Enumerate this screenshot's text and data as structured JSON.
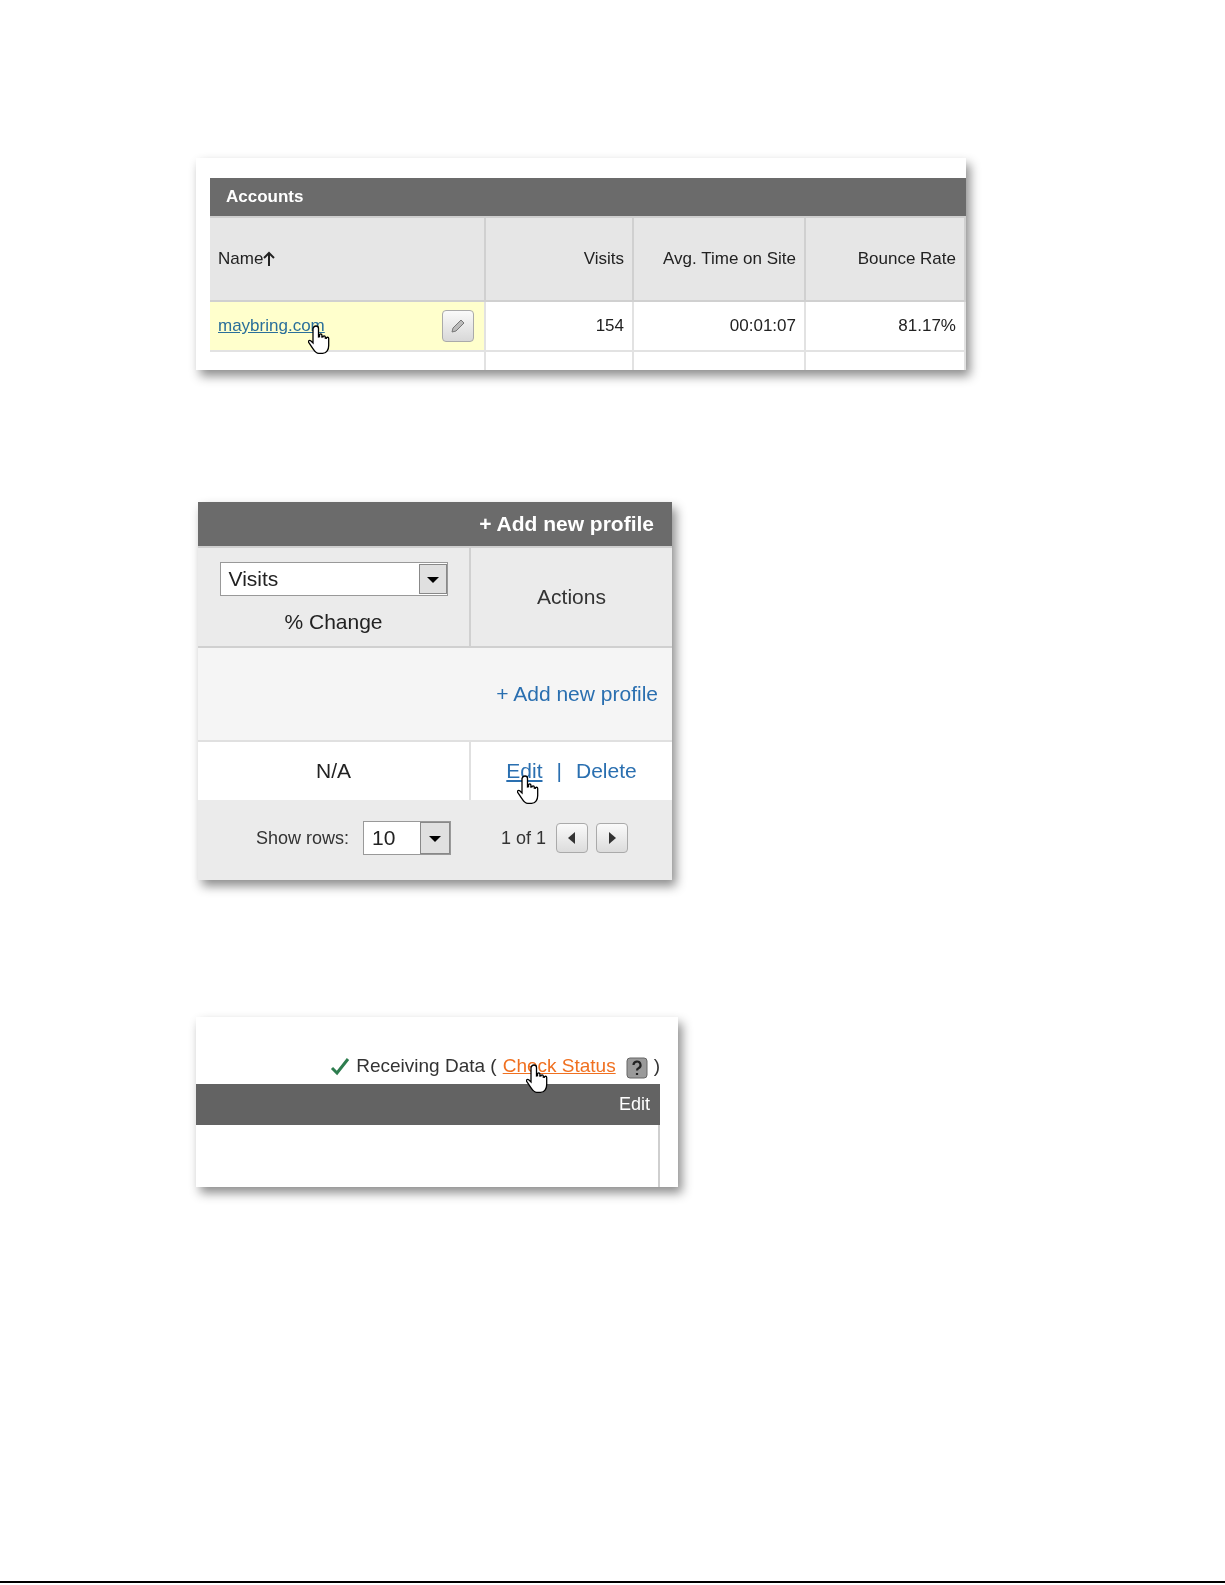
{
  "accounts": {
    "title": "Accounts",
    "columns": [
      {
        "label": "Name",
        "sorted": true
      },
      {
        "label": "Visits",
        "sorted": false
      },
      {
        "label": "Avg. Time on Site",
        "sorted": false
      },
      {
        "label": "Bounce Rate",
        "sorted": false
      }
    ],
    "rows": [
      {
        "cells": [
          "maybring.com",
          "154",
          "00:01:07",
          "81.17%"
        ]
      }
    ]
  },
  "profiles": {
    "header_link": "+ Add new profile",
    "metric_select": {
      "value": "Visits"
    },
    "change_label": "% Change",
    "actions_label": "Actions",
    "add_link": "+ Add new profile",
    "rows": [
      {
        "change": "N/A",
        "actions": [
          "Edit",
          "Delete"
        ]
      }
    ],
    "separator": "|",
    "pager": {
      "show_rows_label": "Show rows:",
      "rows_value": "10",
      "page_info": "1 of 1"
    }
  },
  "status": {
    "text": "Receiving Data (",
    "link": "Check Status",
    "close": ")",
    "bar_label": "Edit"
  }
}
